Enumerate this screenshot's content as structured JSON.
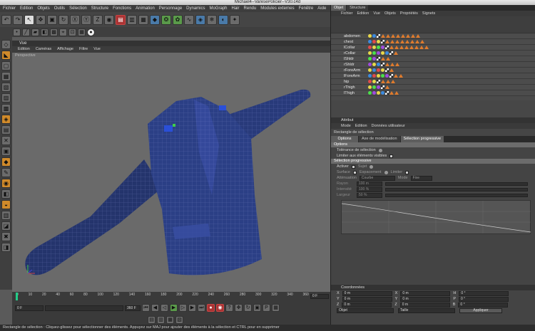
{
  "window": {
    "title": "Michael4--VaresePolicier--V30.c4d"
  },
  "menubar": [
    "Fichier",
    "Edition",
    "Objets",
    "Outils",
    "Sélection",
    "Structure",
    "Fonctions",
    "Animation",
    "Personnage",
    "Dynamics",
    "MoGraph",
    "Hair",
    "Rendu",
    "Modules externes",
    "Fenêtre",
    "Aide"
  ],
  "viewport": {
    "header_label": "Vue",
    "menu": [
      "Edition",
      "Caméras",
      "Affichage",
      "Filtre",
      "Vue"
    ],
    "label": "Perspective"
  },
  "timeline": {
    "ticks": [
      "0",
      "10",
      "20",
      "40",
      "60",
      "80",
      "100",
      "120",
      "140",
      "160",
      "180",
      "200",
      "220",
      "240",
      "260",
      "280",
      "300",
      "320",
      "340",
      "360"
    ],
    "current_frame": "0 F",
    "end_frame": "0 F",
    "start_field": "0 F",
    "mid_field": "360 F"
  },
  "status": {
    "text": "Rectangle de sélection : Cliquez-glissez pour sélectionner des éléments. Appuyez sur MAJ pour ajouter des éléments à la sélection et CTRL pour en supprimer"
  },
  "objects_panel": {
    "tabs": [
      "Objet",
      "Structure"
    ],
    "menu": [
      "Fichier",
      "Edition",
      "Vue",
      "Objets",
      "Propriétés",
      "Signets"
    ],
    "rows": [
      "abdomen",
      "chest",
      "lCollar",
      "rCollar",
      "lShldr",
      "rShldr",
      "rForeArm",
      "lForeArm",
      "hip",
      "rThigh",
      "lThigh"
    ]
  },
  "attributes_panel": {
    "header": "Attribut",
    "menu": [
      "Mode",
      "Edition",
      "Données utilisateur"
    ],
    "tool_name": "Rectangle de sélection",
    "tabs": [
      "Options",
      "Axe de modélisation",
      "Sélection progressive"
    ],
    "options_title": "Options",
    "tolerance_label": "Tolérance de sélection",
    "visible_only_label": "Limiter aux éléments visibles",
    "progressive_title": "Sélection progressive",
    "activer_label": "Activer",
    "sujet_label": "Sujet",
    "surface_label": "Surface",
    "espacement_label": "Espacement",
    "limiter_label": "Limiter",
    "attenuation_label": "Atténuation",
    "attenuation_value": "Courbe",
    "mode_label": "Mode",
    "mode_value": "Fixe",
    "rayon_label": "Rayon",
    "rayon_value": "100 m",
    "intensite_label": "Intensité",
    "intensite_value": "100 %",
    "largeur_label": "Largeur",
    "largeur_value": "50 %"
  },
  "coordinates_panel": {
    "header": "Coordonnées",
    "rows": [
      {
        "axis": "X",
        "v1": "0 m",
        "axis2": "X",
        "v2": "0 m",
        "axis3": "H",
        "v3": "0 °"
      },
      {
        "axis": "Y",
        "v1": "0 m",
        "axis2": "Y",
        "v2": "0 m",
        "axis3": "P",
        "v3": "0 °"
      },
      {
        "axis": "Z",
        "v1": "0 m",
        "axis2": "Z",
        "v2": "0 m",
        "axis3": "B",
        "v3": "0 °"
      }
    ],
    "mode": "Objet",
    "size_mode": "Taille",
    "apply_label": "Appliquer"
  }
}
